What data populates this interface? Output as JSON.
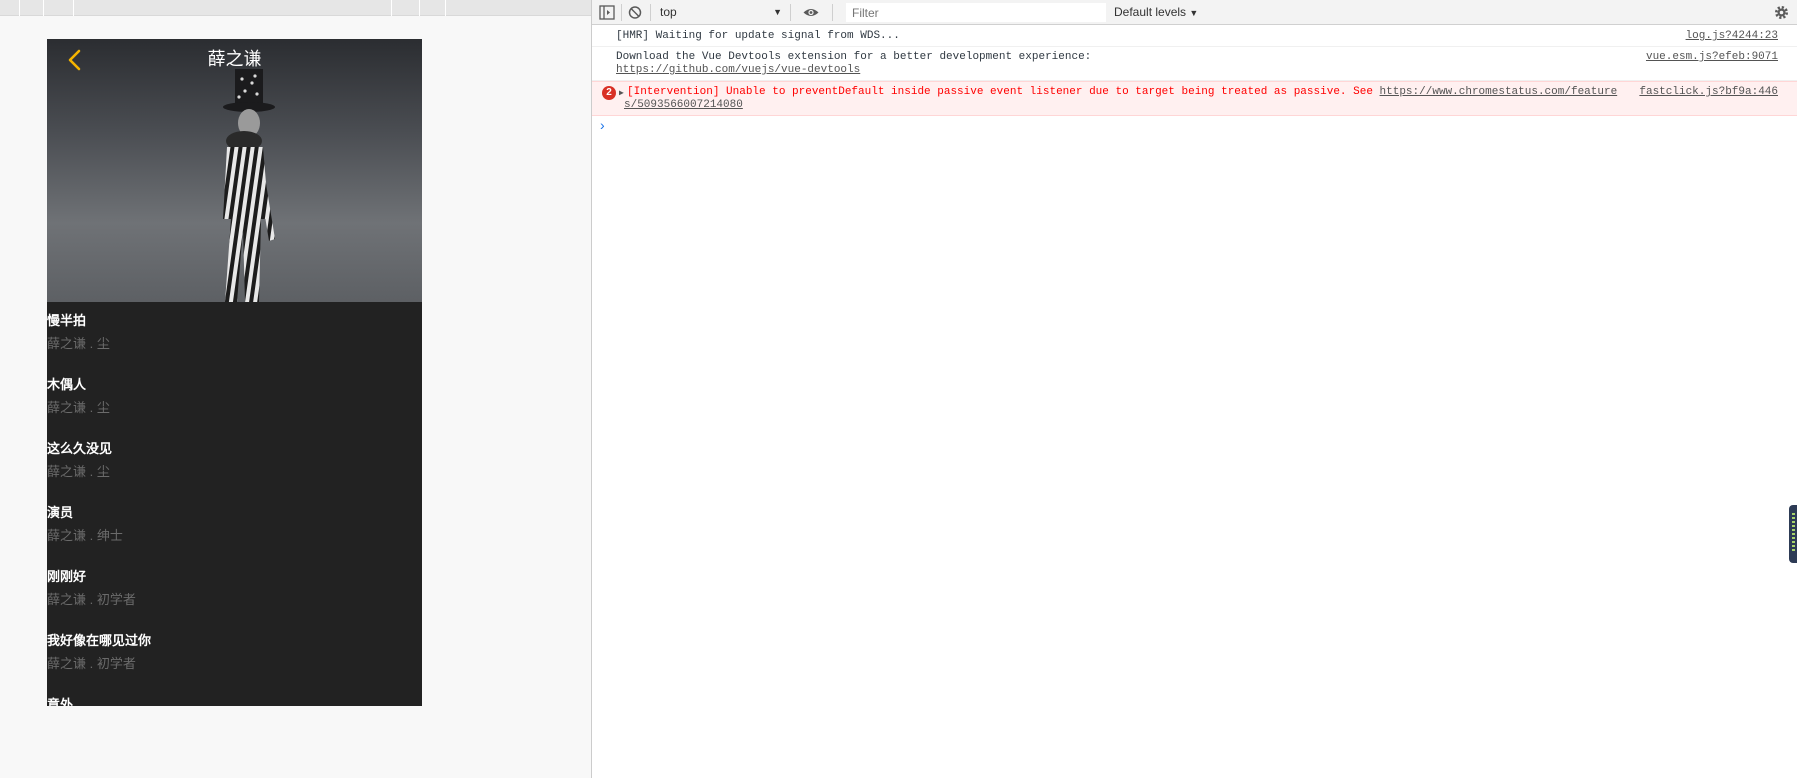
{
  "phone": {
    "singer_name": "薛之谦",
    "songs": [
      {
        "name": "慢半拍",
        "desc": "薛之谦 . 尘"
      },
      {
        "name": "木偶人",
        "desc": "薛之谦 . 尘"
      },
      {
        "name": "这么久没见",
        "desc": "薛之谦 . 尘"
      },
      {
        "name": "演员",
        "desc": "薛之谦 . 绅士"
      },
      {
        "name": "刚刚好",
        "desc": "薛之谦 . 初学者"
      },
      {
        "name": "我好像在哪见过你",
        "desc": "薛之谦 . 初学者"
      },
      {
        "name": "意外",
        "desc": ""
      }
    ],
    "accent_color": "#f5b400"
  },
  "devtools": {
    "context": "top",
    "filter_placeholder": "Filter",
    "levels_label": "Default levels",
    "icons": [
      "sidebar-toggle-icon",
      "clear-console-icon",
      "eye-icon",
      "gear-icon"
    ],
    "messages": [
      {
        "text": "[HMR] Waiting for update signal from WDS...",
        "source": "log.js?4244:23"
      },
      {
        "text": "Download the Vue Devtools extension for a better development experience:",
        "link": "https://github.com/vuejs/vue-devtools",
        "source": "vue.esm.js?efeb:9071"
      }
    ],
    "error": {
      "count": "2",
      "text": "[Intervention] Unable to preventDefault inside passive event listener due to target being treated as passive. See ",
      "link_part1": "https://www.chromestatus.com/feature",
      "link_part2": "s/5093566007214080",
      "source": "fastclick.js?bf9a:446"
    },
    "prompt": "›",
    "error_color": "#ff0000"
  }
}
